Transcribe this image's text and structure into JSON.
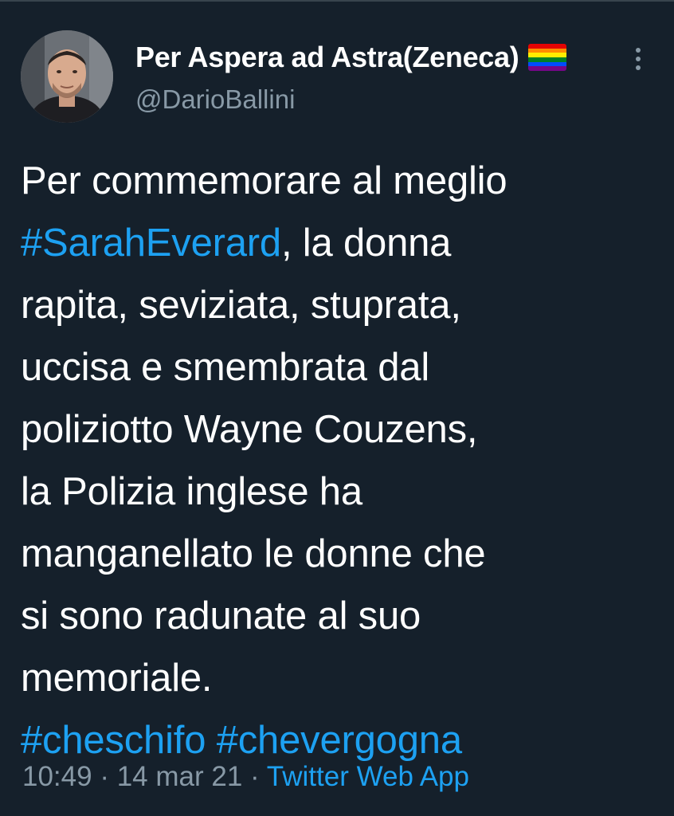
{
  "author": {
    "display_name": "Per Aspera ad Astra(Zeneca)",
    "handle": "@DarioBallini",
    "flag_icon": "rainbow-flag-icon"
  },
  "more_icon": "more-vertical-icon",
  "tweet": {
    "line1": "Per commemorare al meglio",
    "hashtag1": "#SarahEverard",
    "line2_rest": ", la donna",
    "line3": "rapita, seviziata, stuprata,",
    "line4": "uccisa e smembrata dal",
    "line5": "poliziotto Wayne Couzens,",
    "line6": "la Polizia inglese ha",
    "line7": "manganellato le donne che",
    "line8": "si sono radunate al suo",
    "line9": "memoriale.",
    "hashtag2": "#cheschifo",
    "hashtag3": "#chevergogna"
  },
  "meta": {
    "time": "10:49",
    "separator1": " · ",
    "date": "14 mar 21",
    "separator2": " · ",
    "source": "Twitter Web App"
  },
  "colors": {
    "background": "#15202b",
    "text": "#ffffff",
    "secondary": "#8899a6",
    "accent": "#1da1f2"
  }
}
